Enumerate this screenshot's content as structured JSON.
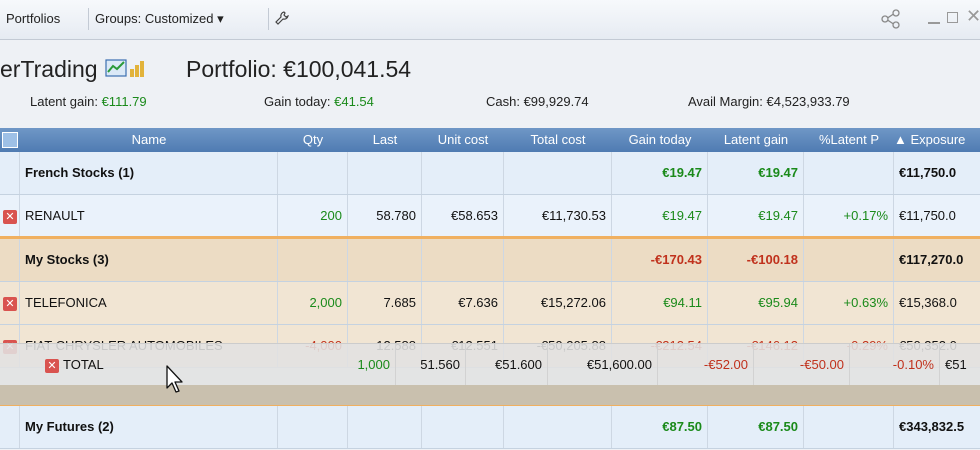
{
  "toolbar": {
    "portfolios_label": "Portfolios",
    "groups_label": "Groups: Customized ▾",
    "wrench_icon": "wrench-icon",
    "share_icon": "share-icon"
  },
  "header": {
    "app_title": "erTrading",
    "portfolio_label": "Portfolio: €100,041.54",
    "latent_gain_label": "Latent gain:",
    "latent_gain_value": "€111.79",
    "gain_today_label": "Gain today:",
    "gain_today_value": "€41.54",
    "cash_label": "Cash: €99,929.74",
    "avail_margin_label": "Avail Margin: €4,523,933.79"
  },
  "columns": [
    "Name",
    "Qty",
    "Last",
    "Unit cost",
    "Total cost",
    "Gain today",
    "Latent gain",
    "%Latent P",
    "▲ Exposure"
  ],
  "groups": [
    {
      "name": "French Stocks (1)",
      "gain_today": "€19.47",
      "latent_gain": "€19.47",
      "exposure": "€11,750.0",
      "items": [
        {
          "name": "RENAULT",
          "qty": "200",
          "last": "58.780",
          "unit_cost": "€58.653",
          "total_cost": "€11,730.53",
          "gain_today": "€19.47",
          "latent_gain": "€19.47",
          "latent_pct": "+0.17%",
          "exposure": "€11,750.0"
        }
      ]
    },
    {
      "name": "My Stocks (3)",
      "gain_today": "-€170.43",
      "latent_gain": "-€100.18",
      "exposure": "€117,270.0",
      "items": [
        {
          "name": "TELEFONICA",
          "qty": "2,000",
          "last": "7.685",
          "unit_cost": "€7.636",
          "total_cost": "€15,272.06",
          "gain_today": "€94.11",
          "latent_gain": "€95.94",
          "latent_pct": "+0.63%",
          "exposure": "€15,368.0"
        },
        {
          "name": "FIAT CHRYSLER AUTOMOBILES",
          "qty": "-4,000",
          "last": "12.588",
          "unit_cost": "€12.551",
          "total_cost": "-€50,205.88",
          "gain_today": "-€212.54",
          "latent_gain": "-€146.12",
          "latent_pct": "-0.29%",
          "exposure": "€50,352.0"
        }
      ]
    },
    {
      "name": "My Futures (2)",
      "gain_today": "€87.50",
      "latent_gain": "€87.50",
      "exposure": "€343,832.5"
    }
  ],
  "drag_row": {
    "name": "TOTAL",
    "qty": "1,000",
    "last": "51.560",
    "unit_cost": "€51.600",
    "total_cost": "€51,600.00",
    "gain_today": "-€52.00",
    "latent_gain": "-€50.00",
    "latent_pct": "-0.10%",
    "exposure": "€51"
  },
  "colors": {
    "gain_positive": "#1a8a1a",
    "gain_negative": "#c0311c",
    "header_blue": "#4f7bb2",
    "group_tan": "#ecdcc4"
  }
}
